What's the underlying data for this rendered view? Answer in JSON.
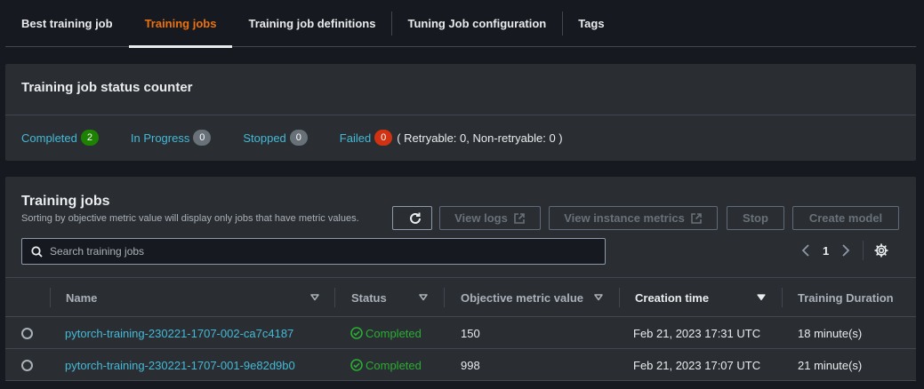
{
  "tabs": [
    {
      "label": "Best training job"
    },
    {
      "label": "Training jobs"
    },
    {
      "label": "Training job definitions"
    },
    {
      "label": "Tuning Job configuration"
    },
    {
      "label": "Tags"
    }
  ],
  "active_tab": "Training jobs",
  "status_counter": {
    "title": "Training job status counter",
    "completed": {
      "label": "Completed",
      "count": "2"
    },
    "in_progress": {
      "label": "In Progress",
      "count": "0"
    },
    "stopped": {
      "label": "Stopped",
      "count": "0"
    },
    "failed": {
      "label": "Failed",
      "count": "0"
    },
    "retry_note": "( Retryable: 0, Non-retryable: 0 )"
  },
  "training_jobs": {
    "title": "Training jobs",
    "subtitle": "Sorting by objective metric value will display only jobs that have metric values.",
    "buttons": {
      "view_logs": "View logs",
      "view_instance_metrics": "View instance metrics",
      "stop": "Stop",
      "create_model": "Create model"
    },
    "search_placeholder": "Search training jobs",
    "page": "1",
    "columns": [
      "Name",
      "Status",
      "Objective metric value",
      "Creation time",
      "Training Duration"
    ],
    "sorted_column": "Creation time",
    "rows": [
      {
        "name": "pytorch-training-230221-1707-002-ca7c4187",
        "status": "Completed",
        "metric": "150",
        "created": "Feb 21, 2023 17:31 UTC",
        "duration": "18 minute(s)"
      },
      {
        "name": "pytorch-training-230221-1707-001-9e82d9b0",
        "status": "Completed",
        "metric": "998",
        "created": "Feb 21, 2023 17:07 UTC",
        "duration": "21 minute(s)"
      }
    ]
  },
  "colors": {
    "accent_active_tab": "#ec7211",
    "link": "#44b9d6",
    "success": "#29ad32",
    "badge_green": "#1d8102",
    "badge_red": "#d13212"
  }
}
